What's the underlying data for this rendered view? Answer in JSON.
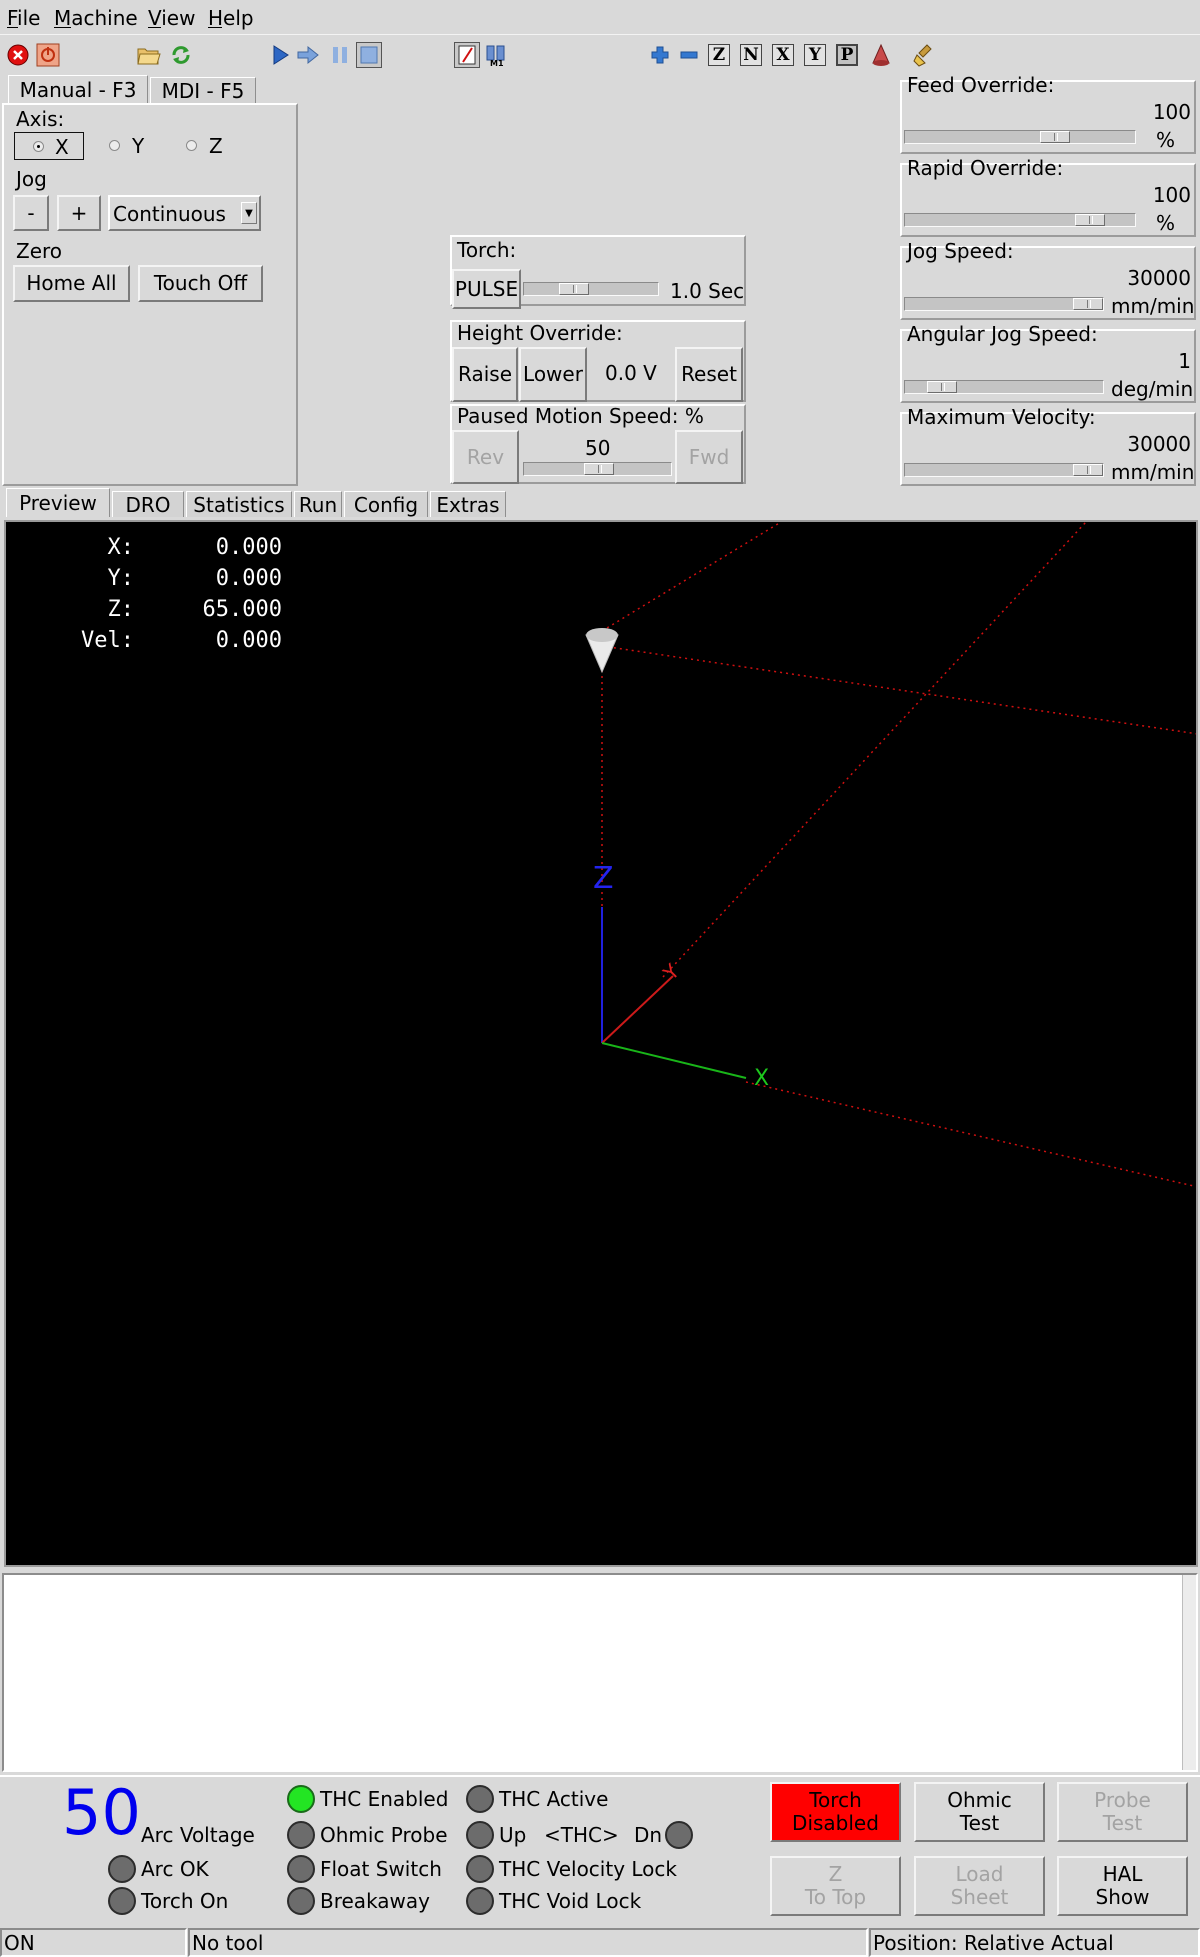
{
  "menu": {
    "items": [
      "File",
      "Machine",
      "View",
      "Help"
    ]
  },
  "toolbar": {
    "icons": [
      "estop-icon",
      "power-icon",
      "open-file-icon",
      "reload-icon",
      "run-icon",
      "step-icon",
      "pause-icon",
      "stop-icon",
      "block-delete-icon",
      "optional-stop-icon",
      "zoom-in-icon",
      "zoom-out-icon",
      "view-z-icon",
      "view-z2-icon",
      "view-x-icon",
      "view-y-icon",
      "view-p-icon",
      "rotate-view-icon",
      "clear-plot-icon"
    ],
    "letters": {
      "z": "Z",
      "z2": "N",
      "x": "X",
      "y": "Y",
      "p": "P"
    }
  },
  "manual": {
    "tabs": [
      "Manual - F3",
      "MDI - F5"
    ],
    "axis_label": "Axis:",
    "axes": [
      "X",
      "Y",
      "Z"
    ],
    "selected_axis": "X",
    "jog_label": "Jog",
    "jog_minus": "-",
    "jog_plus": "+",
    "jog_mode": "Continuous",
    "zero_label": "Zero",
    "home_all": "Home All",
    "touch_off": "Touch Off"
  },
  "torch": {
    "label": "Torch:",
    "pulse": "PULSE",
    "pulse_time": "1.0 Sec",
    "pulse_slider_fraction": 0.35
  },
  "height_override": {
    "label": "Height Override:",
    "raise": "Raise",
    "lower": "Lower",
    "value": "0.0 V",
    "reset": "Reset"
  },
  "paused_motion": {
    "label": "Paused Motion Speed: %",
    "rev": "Rev",
    "fwd": "Fwd",
    "value": "50",
    "slider_fraction": 0.5
  },
  "overrides": {
    "feed": {
      "label": "Feed Override:",
      "value": "100",
      "unit": "%",
      "fraction": 0.6
    },
    "rapid": {
      "label": "Rapid Override:",
      "value": "100",
      "unit": "%",
      "fraction": 0.8
    },
    "jog_speed": {
      "label": "Jog Speed:",
      "value": "30000",
      "unit": "mm/min",
      "fraction": 1.0
    },
    "angular_jog": {
      "label": "Angular Jog Speed:",
      "value": "1",
      "unit": "deg/min",
      "fraction": 0.1
    },
    "max_velocity": {
      "label": "Maximum Velocity:",
      "value": "30000",
      "unit": "mm/min",
      "fraction": 1.0
    }
  },
  "view_tabs": [
    "Preview",
    "DRO",
    "Statistics",
    "Run",
    "Config",
    "Extras"
  ],
  "dro": [
    {
      "axis": "X:",
      "value": "0.000"
    },
    {
      "axis": "Y:",
      "value": "0.000"
    },
    {
      "axis": "Z:",
      "value": "65.000"
    },
    {
      "axis": "Vel:",
      "value": "0.000"
    }
  ],
  "preview_axes": {
    "x": "X",
    "y": "Y",
    "z": "Z"
  },
  "colors": {
    "arc_voltage": "#0000ee",
    "torch_disabled": "#ff0000",
    "led_on": "#23e523",
    "led_off": "#6c6c6c",
    "preview_bg": "#000000"
  },
  "plasma": {
    "arc_voltage_value": "50",
    "arc_voltage_label": "Arc Voltage",
    "arc_ok": "Arc OK",
    "torch_on": "Torch On",
    "thc_enabled": "THC Enabled",
    "ohmic_probe": "Ohmic Probe",
    "float_switch": "Float Switch",
    "breakaway": "Breakaway",
    "thc_active": "THC Active",
    "up": "Up",
    "thc_center": "<THC>",
    "dn": "Dn",
    "thc_velocity_lock": "THC Velocity Lock",
    "thc_void_lock": "THC Void Lock",
    "torch_disabled_1": "Torch",
    "torch_disabled_2": "Disabled",
    "ohmic_test_1": "Ohmic",
    "ohmic_test_2": "Test",
    "probe_test_1": "Probe",
    "probe_test_2": "Test",
    "z_to_top_1": "Z",
    "z_to_top_2": "To Top",
    "load_sheet_1": "Load",
    "load_sheet_2": "Sheet",
    "hal_show_1": "HAL",
    "hal_show_2": "Show"
  },
  "statusbar": {
    "state": "ON",
    "tool": "No tool",
    "position": "Position: Relative Actual"
  }
}
